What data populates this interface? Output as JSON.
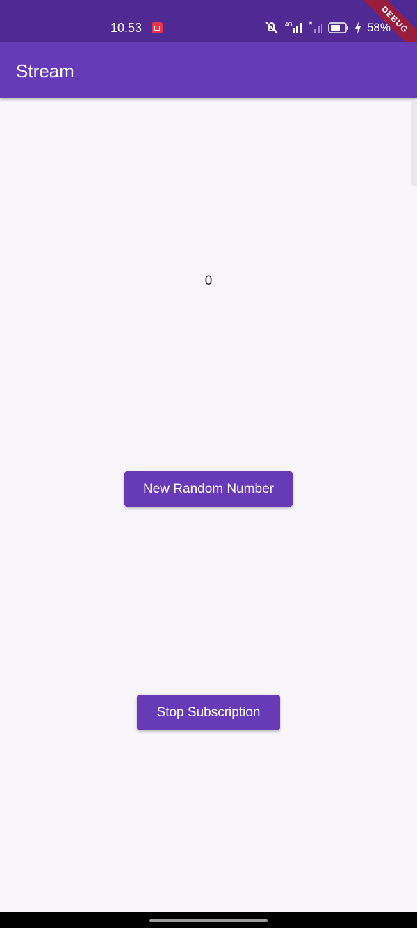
{
  "status_bar": {
    "time": "10.53",
    "battery_percent": "58%",
    "network_label": "4G",
    "debug_label": "DEBUG"
  },
  "app_bar": {
    "title": "Stream"
  },
  "counter": {
    "value": "0"
  },
  "buttons": {
    "new_random": "New Random Number",
    "stop_subscription": "Stop Subscription"
  },
  "colors": {
    "primary": "#673ab7",
    "status_bar": "#4e2a92",
    "background": "#f8f6fa",
    "debug_banner": "#9b1d3d"
  },
  "icons": {
    "record": "screen-record-icon",
    "mute": "mute-icon",
    "signal": "signal-icon",
    "battery": "battery-icon",
    "charging": "charging-icon"
  }
}
